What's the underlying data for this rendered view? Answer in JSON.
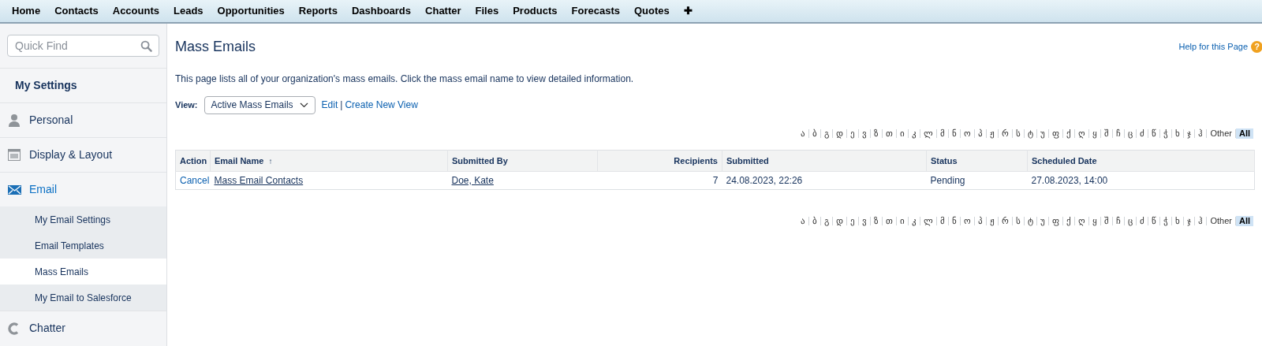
{
  "nav_tabs": [
    {
      "label": "Home"
    },
    {
      "label": "Contacts"
    },
    {
      "label": "Accounts"
    },
    {
      "label": "Leads"
    },
    {
      "label": "Opportunities"
    },
    {
      "label": "Reports"
    },
    {
      "label": "Dashboards"
    },
    {
      "label": "Chatter"
    },
    {
      "label": "Files"
    },
    {
      "label": "Products"
    },
    {
      "label": "Forecasts"
    },
    {
      "label": "Quotes"
    },
    {
      "label": "✚"
    }
  ],
  "sidebar": {
    "search": {
      "placeholder": "Quick Find"
    },
    "heading": "My Settings",
    "items": [
      {
        "label": "Personal",
        "expanded": false
      },
      {
        "label": "Display & Layout",
        "expanded": false
      },
      {
        "label": "Email",
        "expanded": true,
        "children": [
          {
            "label": "My Email Settings",
            "selected": false
          },
          {
            "label": "Email Templates",
            "selected": false
          },
          {
            "label": "Mass Emails",
            "selected": true
          },
          {
            "label": "My Email to Salesforce",
            "selected": false
          }
        ]
      },
      {
        "label": "Chatter",
        "expanded": false
      }
    ]
  },
  "page": {
    "title": "Mass Emails",
    "help_link": "Help for this Page",
    "help_icon": "?",
    "description": "This page lists all of your organization's mass emails. Click the mass email name to view detailed information.",
    "view": {
      "label": "View:",
      "value": "Active Mass Emails",
      "edit_link": "Edit",
      "separator": "|",
      "create_link": "Create New View"
    },
    "alphabet_top": [
      {
        "label": "ა",
        "selected": false
      },
      {
        "label": "ბ",
        "selected": false
      },
      {
        "label": "გ",
        "selected": false
      },
      {
        "label": "დ",
        "selected": false
      },
      {
        "label": "ე",
        "selected": false
      },
      {
        "label": "ვ",
        "selected": false
      },
      {
        "label": "ზ",
        "selected": false
      },
      {
        "label": "თ",
        "selected": false
      },
      {
        "label": "ი",
        "selected": false
      },
      {
        "label": "კ",
        "selected": false
      },
      {
        "label": "ლ",
        "selected": false
      },
      {
        "label": "მ",
        "selected": false
      },
      {
        "label": "ნ",
        "selected": false
      },
      {
        "label": "ო",
        "selected": false
      },
      {
        "label": "პ",
        "selected": false
      },
      {
        "label": "ჟ",
        "selected": false
      },
      {
        "label": "რ",
        "selected": false
      },
      {
        "label": "ს",
        "selected": false
      },
      {
        "label": "ტ",
        "selected": false
      },
      {
        "label": "უ",
        "selected": false
      },
      {
        "label": "ფ",
        "selected": false
      },
      {
        "label": "ქ",
        "selected": false
      },
      {
        "label": "ღ",
        "selected": false
      },
      {
        "label": "ყ",
        "selected": false
      },
      {
        "label": "შ",
        "selected": false
      },
      {
        "label": "ჩ",
        "selected": false
      },
      {
        "label": "ც",
        "selected": false
      },
      {
        "label": "ძ",
        "selected": false
      },
      {
        "label": "წ",
        "selected": false
      },
      {
        "label": "ჭ",
        "selected": false
      },
      {
        "label": "ხ",
        "selected": false
      },
      {
        "label": "ჯ",
        "selected": false
      },
      {
        "label": "ჰ",
        "selected": false
      },
      {
        "label": "Other",
        "selected": false
      },
      {
        "label": "All",
        "selected": true
      }
    ],
    "table": {
      "columns": [
        {
          "label": "Action"
        },
        {
          "label": "Email Name",
          "sort": "↑"
        },
        {
          "label": "Submitted By"
        },
        {
          "label": "Recipients"
        },
        {
          "label": "Submitted"
        },
        {
          "label": "Status"
        },
        {
          "label": "Scheduled Date"
        }
      ],
      "rows": [
        {
          "action": "Cancel",
          "email_name": "Mass Email Contacts",
          "submitted_by": "Doe, Kate",
          "recipients": "7",
          "submitted": "24.08.2023, 22:26",
          "status": "Pending",
          "scheduled_date": "27.08.2023, 14:00"
        }
      ]
    },
    "alphabet_bottom": [
      {
        "label": "ა",
        "selected": false
      },
      {
        "label": "ბ",
        "selected": false
      },
      {
        "label": "გ",
        "selected": false
      },
      {
        "label": "დ",
        "selected": false
      },
      {
        "label": "ე",
        "selected": false
      },
      {
        "label": "ვ",
        "selected": false
      },
      {
        "label": "ზ",
        "selected": false
      },
      {
        "label": "თ",
        "selected": false
      },
      {
        "label": "ი",
        "selected": false
      },
      {
        "label": "კ",
        "selected": false
      },
      {
        "label": "ლ",
        "selected": false
      },
      {
        "label": "მ",
        "selected": false
      },
      {
        "label": "ნ",
        "selected": false
      },
      {
        "label": "ო",
        "selected": false
      },
      {
        "label": "პ",
        "selected": false
      },
      {
        "label": "ჟ",
        "selected": false
      },
      {
        "label": "რ",
        "selected": false
      },
      {
        "label": "ს",
        "selected": false
      },
      {
        "label": "ტ",
        "selected": false
      },
      {
        "label": "უ",
        "selected": false
      },
      {
        "label": "ფ",
        "selected": false
      },
      {
        "label": "ქ",
        "selected": false
      },
      {
        "label": "ღ",
        "selected": false
      },
      {
        "label": "ყ",
        "selected": false
      },
      {
        "label": "შ",
        "selected": false
      },
      {
        "label": "ჩ",
        "selected": false
      },
      {
        "label": "ც",
        "selected": false
      },
      {
        "label": "ძ",
        "selected": false
      },
      {
        "label": "წ",
        "selected": false
      },
      {
        "label": "ჭ",
        "selected": false
      },
      {
        "label": "ხ",
        "selected": false
      },
      {
        "label": "ჯ",
        "selected": false
      },
      {
        "label": "ჰ",
        "selected": false
      },
      {
        "label": "Other",
        "selected": false
      },
      {
        "label": "All",
        "selected": true
      }
    ]
  }
}
